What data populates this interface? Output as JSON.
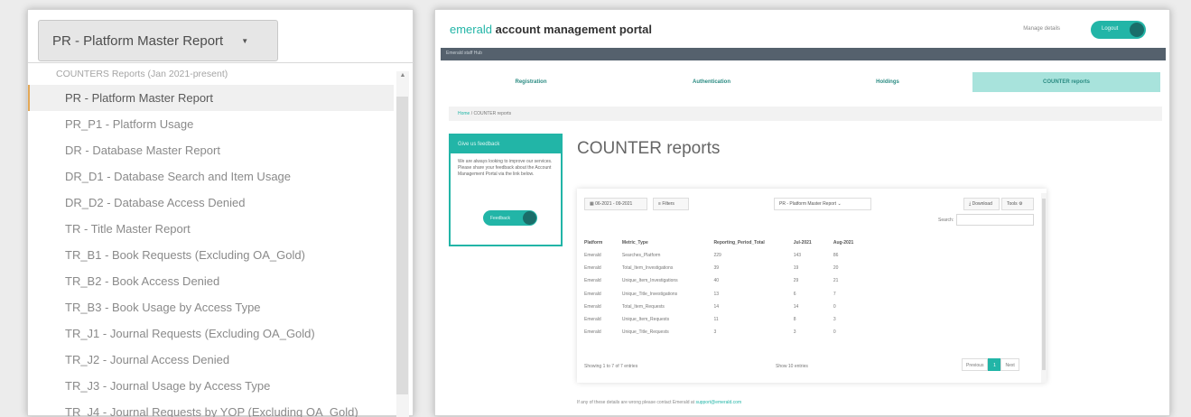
{
  "dropdown": {
    "selected": "PR - Platform Master Report",
    "group_header": "COUNTERS Reports (Jan 2021-present)",
    "items": [
      "PR - Platform Master Report",
      "PR_P1 - Platform Usage",
      "DR - Database Master Report",
      "DR_D1 - Database Search and Item Usage",
      "DR_D2 - Database Access Denied",
      "TR - Title Master Report",
      "TR_B1 - Book Requests (Excluding OA_Gold)",
      "TR_B2 - Book Access Denied",
      "TR_B3 - Book Usage by Access Type",
      "TR_J1 - Journal Requests (Excluding OA_Gold)",
      "TR_J2 - Journal Access Denied",
      "TR_J3 - Journal Usage by Access Type",
      "TR_J4 - Journal Requests by YOP (Excluding OA_Gold)"
    ],
    "active_index": 0
  },
  "portal": {
    "brand_logo": "emerald",
    "brand_title": "account management portal",
    "manage_users": "Manage details",
    "logout": "Logout",
    "user_bar": "Emerald staff Hub",
    "nav": [
      "Registration",
      "Authentication",
      "Holdings",
      "COUNTER reports"
    ],
    "active_nav": 3,
    "breadcrumb_home": "Home",
    "breadcrumb_current": "/ COUNTER reports",
    "feedback": {
      "header": "Give us feedback",
      "body": "We are always looking to improve our services. Please share your feedback about the Account Management Portal via the link below.",
      "button": "Feedback"
    },
    "page_title": "COUNTER reports",
    "filters": {
      "date_range": "06-2021 - 09-2021",
      "filters_btn": "Filters",
      "report_select": "PR - Platform Master Report",
      "download": "Download",
      "tools": "Tools"
    },
    "search_label": "Search:",
    "table": {
      "headers": [
        "Platform",
        "Metric_Type",
        "Reporting_Period_Total",
        "Jul-2021",
        "Aug-2021"
      ],
      "rows": [
        [
          "Emerald",
          "Searches_Platform",
          "229",
          "143",
          "86"
        ],
        [
          "Emerald",
          "Total_Item_Investigations",
          "39",
          "19",
          "20"
        ],
        [
          "Emerald",
          "Unique_Item_Investigations",
          "40",
          "29",
          "21"
        ],
        [
          "Emerald",
          "Unique_Title_Investigations",
          "13",
          "6",
          "7"
        ],
        [
          "Emerald",
          "Total_Item_Requests",
          "14",
          "14",
          "0"
        ],
        [
          "Emerald",
          "Unique_Item_Requests",
          "11",
          "8",
          "3"
        ],
        [
          "Emerald",
          "Unique_Title_Requests",
          "3",
          "3",
          "0"
        ]
      ]
    },
    "showing": "Showing 1 to 7 of 7 entries",
    "show_entries": "Show  10  entries",
    "pager": {
      "prev": "Previous",
      "current": "1",
      "next": "Next"
    },
    "footer_text": "If any of these details are wrong please contact Emerald at",
    "footer_link": "support@emerald.com"
  }
}
